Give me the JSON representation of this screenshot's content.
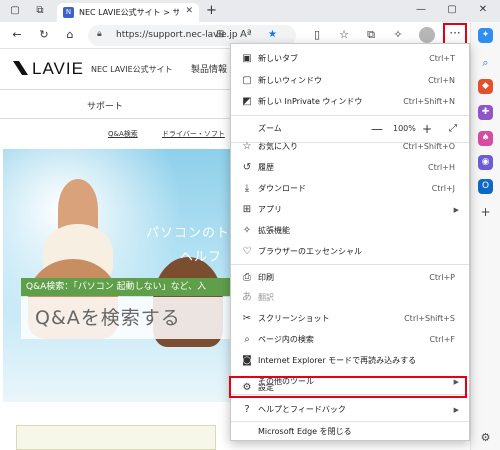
{
  "tab": {
    "title": "NEC LAVIE公式サイト > サービス＆サ"
  },
  "address": {
    "url": "https://support.nec-lavie.jp"
  },
  "site": {
    "logo": "LAVIE",
    "name": "NEC LAVIE公式サイト",
    "product": "製品情報",
    "support": "サポート",
    "link_qa": "Q&A検索",
    "link_driver": "ドライバー・ソフト",
    "hero_text1": "パソコンのト",
    "hero_text2": "ヘルフ",
    "qa_banner": "Q&A検索：「パソコン 起動しない」など、入",
    "qa_search": "Q&Aを検索する"
  },
  "menu": {
    "new_tab": "新しいタブ",
    "new_tab_sc": "Ctrl+T",
    "new_window": "新しいウィンドウ",
    "new_window_sc": "Ctrl+N",
    "new_private": "新しい InPrivate ウィンドウ",
    "new_private_sc": "Ctrl+Shift+N",
    "zoom": "ズーム",
    "zoom_minus": "—",
    "zoom_value": "100%",
    "zoom_plus": "+",
    "favorites": "お気に入り",
    "favorites_sc": "Ctrl+Shift+O",
    "history": "履歴",
    "history_sc": "Ctrl+H",
    "downloads": "ダウンロード",
    "downloads_sc": "Ctrl+J",
    "apps": "アプリ",
    "extensions": "拡張機能",
    "essentials": "ブラウザーのエッセンシャル",
    "print": "印刷",
    "print_sc": "Ctrl+P",
    "translate": "翻訳",
    "screenshot": "スクリーンショット",
    "screenshot_sc": "Ctrl+Shift+S",
    "find": "ページ内の検索",
    "find_sc": "Ctrl+F",
    "ie_mode": "Internet Explorer モードで再読み込みする",
    "more_tools": "その他のツール",
    "settings": "設定",
    "help": "ヘルプとフィードバック",
    "close_edge": "Microsoft Edge を閉じる"
  },
  "colors": {
    "highlight": "#e60012",
    "edge_green": "#5f9f4a"
  }
}
